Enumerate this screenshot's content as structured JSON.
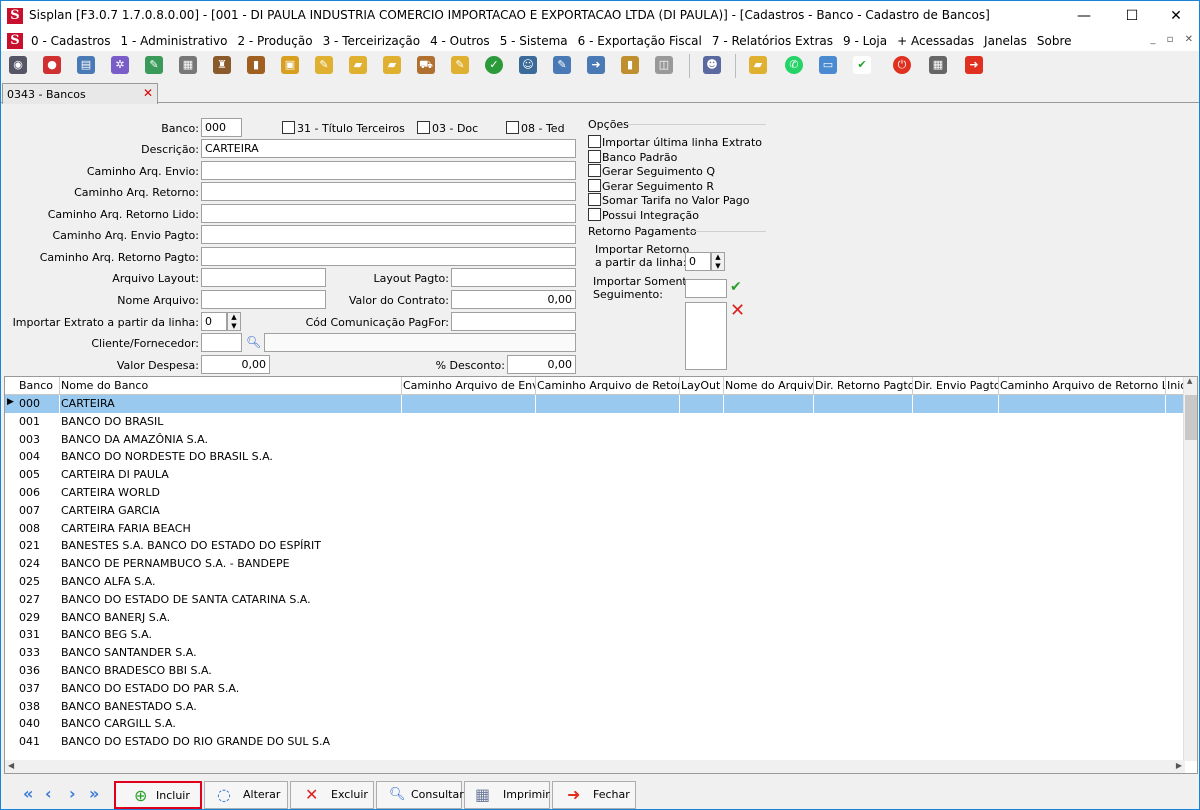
{
  "window": {
    "title": "Sisplan [F3.0.7 1.7.0.8.0.00] - [001 - DI PAULA INDUSTRIA COMERCIO IMPORTACAO E EXPORTACAO LTDA (DI PAULA)] - [Cadastros - Banco - Cadastro de Bancos]",
    "logo": "S",
    "minimize": "—",
    "maximize": "☐",
    "close": "✕"
  },
  "menu": {
    "items": [
      "0 - Cadastros",
      "1 - Administrativo",
      "2 - Produção",
      "3 - Terceirização",
      "4 - Outros",
      "5 - Sistema",
      "6 - Exportação Fiscal",
      "7 - Relatórios Extras",
      "9 - Loja",
      "+ Acessadas",
      "Janelas",
      "Sobre"
    ],
    "mdi": "_  ▫  ✕"
  },
  "tab": {
    "label": "0343 - Bancos",
    "close": "✕"
  },
  "form": {
    "banco_label": "Banco:",
    "banco_value": "000",
    "titulo_terceiros": "31 - Título Terceiros",
    "doc": "03 - Doc",
    "ted": "08 - Ted",
    "descricao_label": "Descrição:",
    "descricao_value": "CARTEIRA",
    "cam_envio_label": "Caminho Arq. Envio:",
    "cam_retorno_label": "Caminho Arq. Retorno:",
    "cam_retorno_lido_label": "Caminho Arq. Retorno Lido:",
    "cam_envio_pagto_label": "Caminho Arq. Envio Pagto:",
    "cam_retorno_pagto_label": "Caminho Arq. Retorno Pagto:",
    "arquivo_layout_label": "Arquivo Layout:",
    "layout_pagto_label": "Layout Pagto:",
    "nome_arquivo_label": "Nome Arquivo:",
    "valor_contrato_label": "Valor do Contrato:",
    "valor_contrato_value": "0,00",
    "importar_extrato_label": "Importar Extrato a partir da linha:",
    "importar_extrato_value": "0",
    "cod_comunicacao_label": "Cód Comunicação PagFor:",
    "cliente_label": "Cliente/Fornecedor:",
    "valor_despesa_label": "Valor Despesa:",
    "valor_despesa_value": "0,00",
    "desconto_label": "% Desconto:",
    "desconto_value": "0,00"
  },
  "opcoes": {
    "title": "Opções",
    "items": [
      "Importar última linha Extrato",
      "Banco Padrão",
      "Gerar Seguimento Q",
      "Gerar Seguimento R",
      "Somar Tarifa no Valor Pago",
      "Possui Integração"
    ]
  },
  "retorno": {
    "title": "Retorno Pagamento",
    "importar_label_1": "Importar Retorno",
    "importar_label_2": "a partir da linha:",
    "importar_value": "0",
    "somente_label_1": "Importar Somente",
    "somente_label_2": "Seguimento:"
  },
  "grid": {
    "columns": [
      "Banco",
      "Nome do Banco",
      "Caminho Arquivo de Envio",
      "Caminho Arquivo de Retorno",
      "LayOut",
      "Nome do Arquivo",
      "Dir. Retorno Pagto",
      "Dir. Envio Pagto",
      "Caminho Arquivo de Retorno Lido",
      "Inic"
    ],
    "rows": [
      [
        "000",
        "CARTEIRA"
      ],
      [
        "001",
        "BANCO DO BRASIL"
      ],
      [
        "003",
        "BANCO DA AMAZÔNIA S.A."
      ],
      [
        "004",
        "BANCO DO NORDESTE DO BRASIL S.A."
      ],
      [
        "005",
        "CARTEIRA DI PAULA"
      ],
      [
        "006",
        "CARTEIRA WORLD"
      ],
      [
        "007",
        "CARTEIRA GARCIA"
      ],
      [
        "008",
        "CARTEIRA FARIA BEACH"
      ],
      [
        "021",
        "BANESTES S.A. BANCO DO ESTADO DO ESPÍRIT"
      ],
      [
        "024",
        "BANCO DE PERNAMBUCO S.A. - BANDEPE"
      ],
      [
        "025",
        "BANCO ALFA S.A."
      ],
      [
        "027",
        "BANCO DO ESTADO DE SANTA CATARINA S.A."
      ],
      [
        "029",
        "BANCO BANERJ S.A."
      ],
      [
        "031",
        "BANCO BEG S.A."
      ],
      [
        "033",
        "BANCO SANTANDER S.A."
      ],
      [
        "036",
        "BANCO BRADESCO BBI S.A."
      ],
      [
        "037",
        "BANCO DO ESTADO DO PAR  S.A."
      ],
      [
        "038",
        "BANCO BANESTADO S.A."
      ],
      [
        "040",
        "BANCO CARGILL S.A."
      ],
      [
        "041",
        "BANCO DO ESTADO DO RIO GRANDE DO SUL S.A"
      ]
    ]
  },
  "buttons": {
    "incluir": "Incluir",
    "alterar": "Alterar",
    "excluir": "Excluir",
    "consultar": "Consultar",
    "imprimir": "Imprimir",
    "fechar": "Fechar"
  },
  "colors": {
    "accent": "#1883d7",
    "selected_row": "#99c9ef",
    "highlight_border": "#e0001b"
  }
}
